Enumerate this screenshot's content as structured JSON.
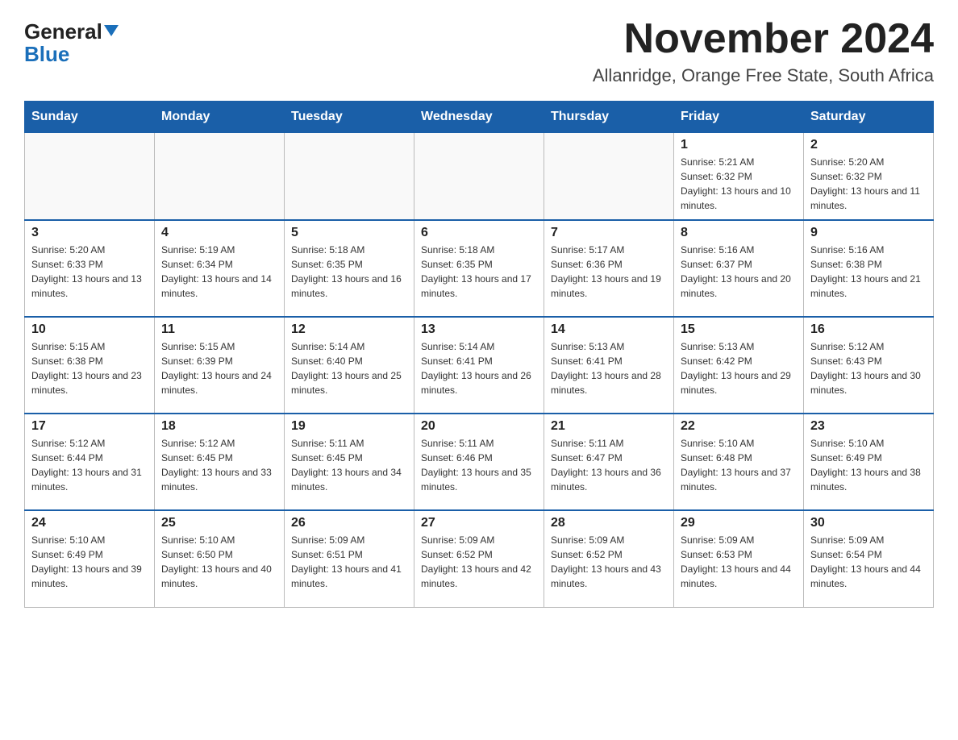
{
  "header": {
    "logo_general": "General",
    "logo_blue": "Blue",
    "month_title": "November 2024",
    "location": "Allanridge, Orange Free State, South Africa"
  },
  "weekdays": [
    "Sunday",
    "Monday",
    "Tuesday",
    "Wednesday",
    "Thursday",
    "Friday",
    "Saturday"
  ],
  "weeks": [
    [
      {
        "day": "",
        "sunrise": "",
        "sunset": "",
        "daylight": ""
      },
      {
        "day": "",
        "sunrise": "",
        "sunset": "",
        "daylight": ""
      },
      {
        "day": "",
        "sunrise": "",
        "sunset": "",
        "daylight": ""
      },
      {
        "day": "",
        "sunrise": "",
        "sunset": "",
        "daylight": ""
      },
      {
        "day": "",
        "sunrise": "",
        "sunset": "",
        "daylight": ""
      },
      {
        "day": "1",
        "sunrise": "Sunrise: 5:21 AM",
        "sunset": "Sunset: 6:32 PM",
        "daylight": "Daylight: 13 hours and 10 minutes."
      },
      {
        "day": "2",
        "sunrise": "Sunrise: 5:20 AM",
        "sunset": "Sunset: 6:32 PM",
        "daylight": "Daylight: 13 hours and 11 minutes."
      }
    ],
    [
      {
        "day": "3",
        "sunrise": "Sunrise: 5:20 AM",
        "sunset": "Sunset: 6:33 PM",
        "daylight": "Daylight: 13 hours and 13 minutes."
      },
      {
        "day": "4",
        "sunrise": "Sunrise: 5:19 AM",
        "sunset": "Sunset: 6:34 PM",
        "daylight": "Daylight: 13 hours and 14 minutes."
      },
      {
        "day": "5",
        "sunrise": "Sunrise: 5:18 AM",
        "sunset": "Sunset: 6:35 PM",
        "daylight": "Daylight: 13 hours and 16 minutes."
      },
      {
        "day": "6",
        "sunrise": "Sunrise: 5:18 AM",
        "sunset": "Sunset: 6:35 PM",
        "daylight": "Daylight: 13 hours and 17 minutes."
      },
      {
        "day": "7",
        "sunrise": "Sunrise: 5:17 AM",
        "sunset": "Sunset: 6:36 PM",
        "daylight": "Daylight: 13 hours and 19 minutes."
      },
      {
        "day": "8",
        "sunrise": "Sunrise: 5:16 AM",
        "sunset": "Sunset: 6:37 PM",
        "daylight": "Daylight: 13 hours and 20 minutes."
      },
      {
        "day": "9",
        "sunrise": "Sunrise: 5:16 AM",
        "sunset": "Sunset: 6:38 PM",
        "daylight": "Daylight: 13 hours and 21 minutes."
      }
    ],
    [
      {
        "day": "10",
        "sunrise": "Sunrise: 5:15 AM",
        "sunset": "Sunset: 6:38 PM",
        "daylight": "Daylight: 13 hours and 23 minutes."
      },
      {
        "day": "11",
        "sunrise": "Sunrise: 5:15 AM",
        "sunset": "Sunset: 6:39 PM",
        "daylight": "Daylight: 13 hours and 24 minutes."
      },
      {
        "day": "12",
        "sunrise": "Sunrise: 5:14 AM",
        "sunset": "Sunset: 6:40 PM",
        "daylight": "Daylight: 13 hours and 25 minutes."
      },
      {
        "day": "13",
        "sunrise": "Sunrise: 5:14 AM",
        "sunset": "Sunset: 6:41 PM",
        "daylight": "Daylight: 13 hours and 26 minutes."
      },
      {
        "day": "14",
        "sunrise": "Sunrise: 5:13 AM",
        "sunset": "Sunset: 6:41 PM",
        "daylight": "Daylight: 13 hours and 28 minutes."
      },
      {
        "day": "15",
        "sunrise": "Sunrise: 5:13 AM",
        "sunset": "Sunset: 6:42 PM",
        "daylight": "Daylight: 13 hours and 29 minutes."
      },
      {
        "day": "16",
        "sunrise": "Sunrise: 5:12 AM",
        "sunset": "Sunset: 6:43 PM",
        "daylight": "Daylight: 13 hours and 30 minutes."
      }
    ],
    [
      {
        "day": "17",
        "sunrise": "Sunrise: 5:12 AM",
        "sunset": "Sunset: 6:44 PM",
        "daylight": "Daylight: 13 hours and 31 minutes."
      },
      {
        "day": "18",
        "sunrise": "Sunrise: 5:12 AM",
        "sunset": "Sunset: 6:45 PM",
        "daylight": "Daylight: 13 hours and 33 minutes."
      },
      {
        "day": "19",
        "sunrise": "Sunrise: 5:11 AM",
        "sunset": "Sunset: 6:45 PM",
        "daylight": "Daylight: 13 hours and 34 minutes."
      },
      {
        "day": "20",
        "sunrise": "Sunrise: 5:11 AM",
        "sunset": "Sunset: 6:46 PM",
        "daylight": "Daylight: 13 hours and 35 minutes."
      },
      {
        "day": "21",
        "sunrise": "Sunrise: 5:11 AM",
        "sunset": "Sunset: 6:47 PM",
        "daylight": "Daylight: 13 hours and 36 minutes."
      },
      {
        "day": "22",
        "sunrise": "Sunrise: 5:10 AM",
        "sunset": "Sunset: 6:48 PM",
        "daylight": "Daylight: 13 hours and 37 minutes."
      },
      {
        "day": "23",
        "sunrise": "Sunrise: 5:10 AM",
        "sunset": "Sunset: 6:49 PM",
        "daylight": "Daylight: 13 hours and 38 minutes."
      }
    ],
    [
      {
        "day": "24",
        "sunrise": "Sunrise: 5:10 AM",
        "sunset": "Sunset: 6:49 PM",
        "daylight": "Daylight: 13 hours and 39 minutes."
      },
      {
        "day": "25",
        "sunrise": "Sunrise: 5:10 AM",
        "sunset": "Sunset: 6:50 PM",
        "daylight": "Daylight: 13 hours and 40 minutes."
      },
      {
        "day": "26",
        "sunrise": "Sunrise: 5:09 AM",
        "sunset": "Sunset: 6:51 PM",
        "daylight": "Daylight: 13 hours and 41 minutes."
      },
      {
        "day": "27",
        "sunrise": "Sunrise: 5:09 AM",
        "sunset": "Sunset: 6:52 PM",
        "daylight": "Daylight: 13 hours and 42 minutes."
      },
      {
        "day": "28",
        "sunrise": "Sunrise: 5:09 AM",
        "sunset": "Sunset: 6:52 PM",
        "daylight": "Daylight: 13 hours and 43 minutes."
      },
      {
        "day": "29",
        "sunrise": "Sunrise: 5:09 AM",
        "sunset": "Sunset: 6:53 PM",
        "daylight": "Daylight: 13 hours and 44 minutes."
      },
      {
        "day": "30",
        "sunrise": "Sunrise: 5:09 AM",
        "sunset": "Sunset: 6:54 PM",
        "daylight": "Daylight: 13 hours and 44 minutes."
      }
    ]
  ]
}
